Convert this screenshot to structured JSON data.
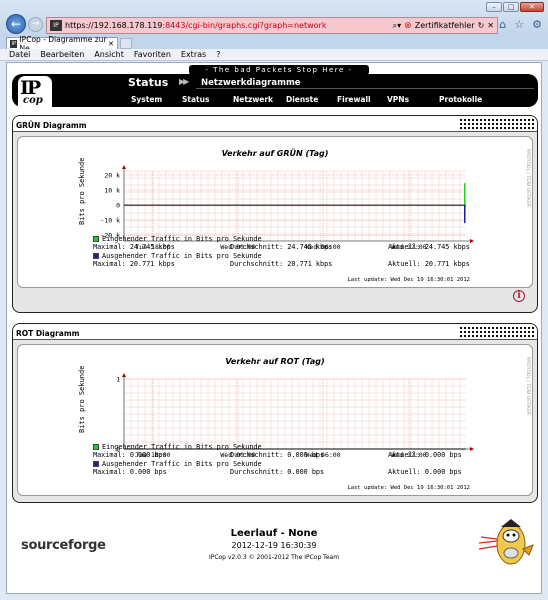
{
  "browser": {
    "url_host": "https://192.168.178.119",
    "url_path": ":8443/cgi-bin/graphs.cgi?graph=network",
    "cert_error": "Zertifikatfehler",
    "tab_title": "IPCop - Diagramme zur Ne...",
    "favicon_text": "IP",
    "menu": [
      "Datei",
      "Bearbeiten",
      "Ansicht",
      "Favoriten",
      "Extras",
      "?"
    ]
  },
  "header": {
    "slogan": "- The bad Packets Stop Here -",
    "logo_ip": "IP",
    "logo_cop": "cop",
    "crumb_section": "Status",
    "crumb_page": "Netzwerkdiagramme",
    "nav": [
      "System",
      "Status",
      "Netzwerk",
      "Dienste",
      "Firewall",
      "VPNs",
      "Protokolle"
    ]
  },
  "green": {
    "panel_title": "GRÜN Diagramm",
    "graph_title": "Verkehr auf GRÜN (Tag)",
    "ylabel": "Bits pro Sekunde",
    "side_mark": "RRDTOOL / TOBI OETIKER",
    "yticks": [
      "20 k",
      "10 k",
      "0",
      "-10 k",
      "-20 k"
    ],
    "xticks": [
      "Tue 18:00",
      "Wed 00:00",
      "Wed 06:00",
      "Wed 12:00"
    ],
    "in_label": "Eingehender Traffic in Bits pro Sekunde",
    "in_max": "Maximal:   24.745 kbps",
    "in_avg": "Durchschnitt:  24.745 kbps",
    "in_cur": "Aktuell:   24.745 kbps",
    "out_label": "Ausgehender Traffic in Bits pro Sekunde",
    "out_max": "Maximal:   20.771 kbps",
    "out_avg": "Durchschnitt:  20.771 kbps",
    "out_cur": "Aktuell:   20.771 kbps",
    "last_update": "Last update: Wed Dec 19 16:30:01 2012"
  },
  "red": {
    "panel_title": "ROT Diagramm",
    "graph_title": "Verkehr auf ROT (Tag)",
    "ylabel": "Bits pro Sekunde",
    "side_mark": "RRDTOOL / TOBI OETIKER",
    "yticks": [
      "1",
      "0"
    ],
    "xticks": [
      "Tue 18:00",
      "Wed 00:00",
      "Wed 06:00",
      "Wed 12:00"
    ],
    "in_label": "Eingehender Traffic in Bits pro Sekunde",
    "in_max": "Maximal:    0.000  bps",
    "in_avg": "Durchschnitt:    0.000  bps",
    "in_cur": "Aktuell:    0.000  bps",
    "out_label": "Ausgehender Traffic in Bits pro Sekunde",
    "out_max": "Maximal:    0.000  bps",
    "out_avg": "Durchschnitt:    0.000  bps",
    "out_cur": "Aktuell:    0.000  bps",
    "last_update": "Last update: Wed Dec 19 16:30:01 2012"
  },
  "footer": {
    "sourceforge": "sourceforge",
    "status": "Leerlauf - None",
    "datetime": "2012-12-19 16:30:39",
    "copyright": "IPCop v2.0.3 © 2001-2012 The IPCop Team"
  },
  "colors": {
    "incoming": "#20d020",
    "outgoing": "#1c1c9c",
    "grid": "#f0c8c8",
    "axis_arrow": "#b00000"
  }
}
